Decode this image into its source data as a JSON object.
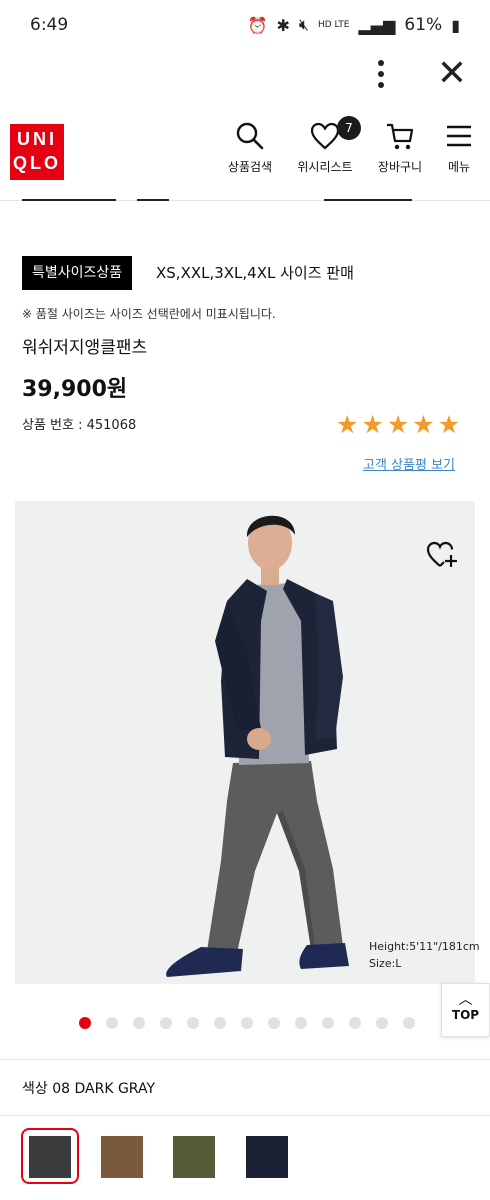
{
  "status_bar": {
    "time": "6:49",
    "network": "HD LTE",
    "battery": "61%"
  },
  "brand": {
    "line1": "UNI",
    "line2": "QLO",
    "color": "#e60012"
  },
  "header_nav": [
    {
      "label": "상품검색",
      "icon": "search-icon"
    },
    {
      "label": "위시리스트",
      "icon": "heart-icon",
      "badge": "7"
    },
    {
      "label": "장바구니",
      "icon": "cart-icon"
    },
    {
      "label": "메뉴",
      "icon": "hamburger-icon"
    }
  ],
  "product": {
    "special_badge": "특별사이즈상품",
    "sizes_text": "XS,XXL,3XL,4XL 사이즈 판매",
    "notice": "※ 품절 사이즈는 사이즈 선택란에서 미표시됩니다.",
    "name": "워쉬저지앵클팬츠",
    "price": "39,900원",
    "number": "상품 번호 : 451068",
    "rating": 5,
    "review_link": "고객 상품평 보기"
  },
  "image": {
    "model_height": "Height:5'11\"/181cm",
    "model_size": "Size:L",
    "wishlist_icon": "heart-plus-icon"
  },
  "carousel": {
    "total": 13,
    "active": 1
  },
  "top_button": {
    "label": "TOP"
  },
  "color": {
    "label": "색상 08 DARK GRAY",
    "swatches": [
      "#3a3b3d",
      "#7a5a3d",
      "#565a37",
      "#1c2233"
    ],
    "selected_index": 0
  }
}
